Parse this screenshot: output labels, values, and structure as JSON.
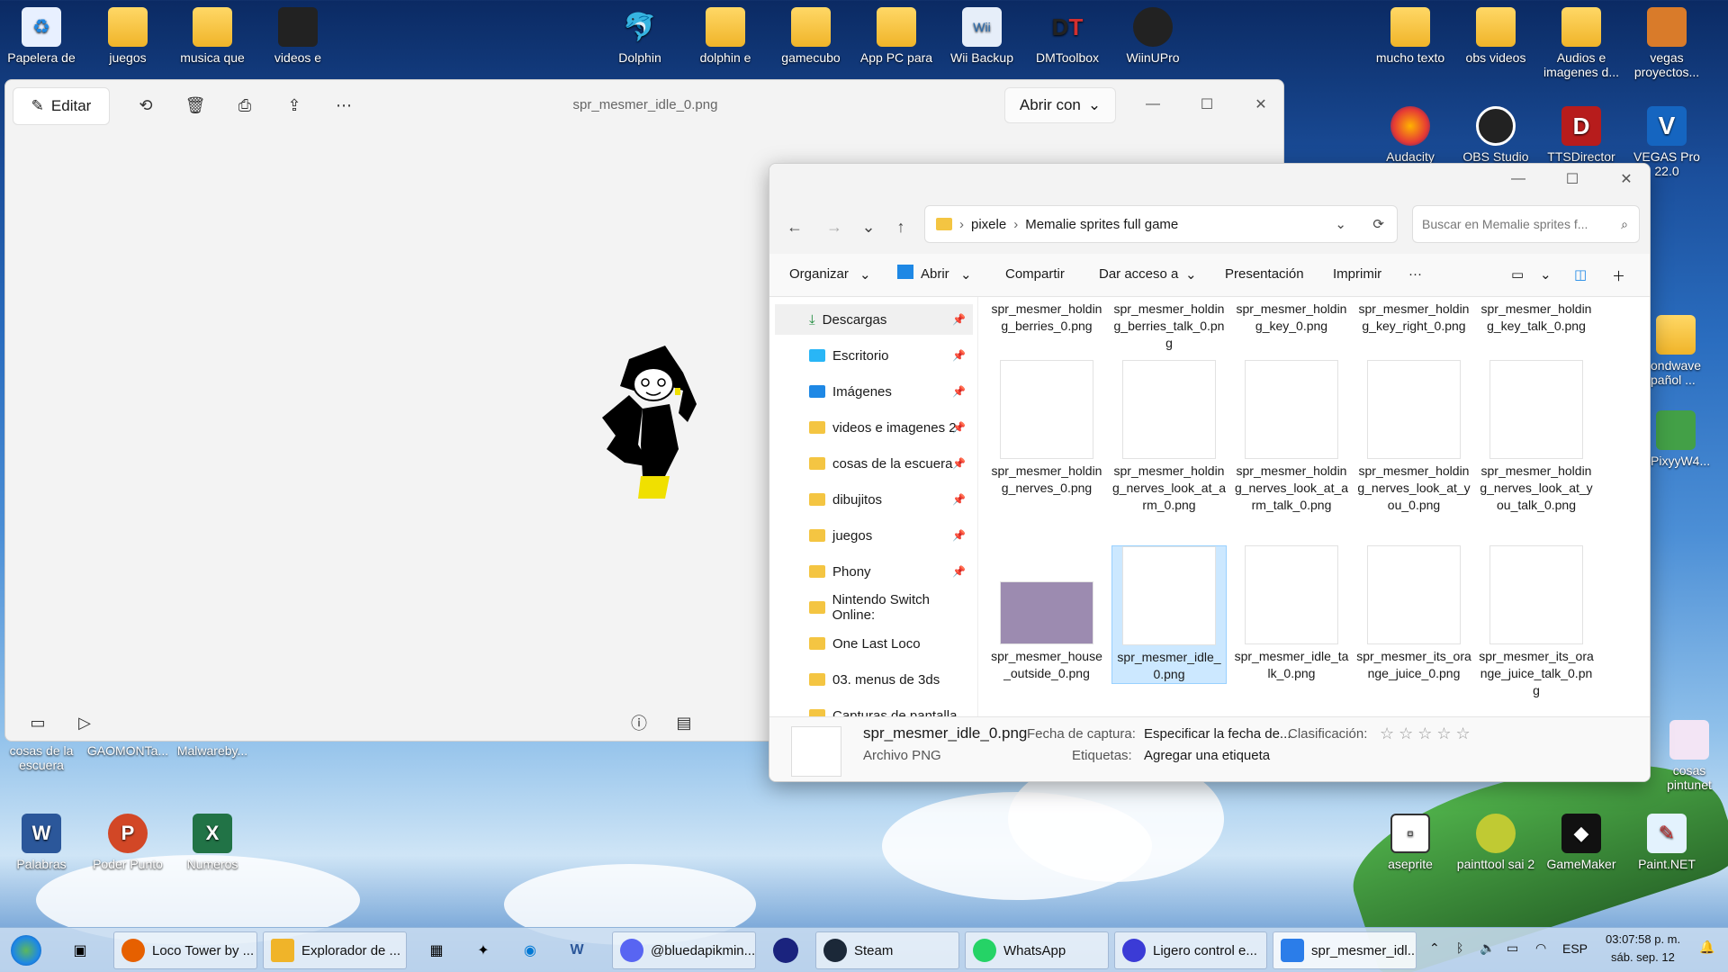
{
  "desktop_icons": [
    {
      "label": "Papelera de",
      "icon": "recycle-bin-icon"
    },
    {
      "label": "juegos",
      "icon": "folder-icon"
    },
    {
      "label": "musica que",
      "icon": "folder-icon"
    },
    {
      "label": "videos e",
      "icon": "folder-icon"
    },
    {
      "label": "Dolphin",
      "icon": "dolphin-icon"
    },
    {
      "label": "dolphin e",
      "icon": "folder-icon"
    },
    {
      "label": "gamecubo",
      "icon": "folder-icon"
    },
    {
      "label": "App PC para",
      "icon": "folder-icon"
    },
    {
      "label": "Wii Backup",
      "icon": "wii-backup-icon"
    },
    {
      "label": "DMToolbox",
      "icon": "dmtoolbox-icon"
    },
    {
      "label": "WiinUPro",
      "icon": "wiinupro-icon"
    },
    {
      "label": "mucho texto",
      "icon": "folder-icon"
    },
    {
      "label": "obs videos",
      "icon": "folder-icon"
    },
    {
      "label": "Audios e imagenes d...",
      "icon": "folder-icon"
    },
    {
      "label": "vegas proyectos...",
      "icon": "vegas-projects-icon"
    },
    {
      "label": "Audacity",
      "icon": "audacity-icon"
    },
    {
      "label": "OBS Studio",
      "icon": "obs-icon"
    },
    {
      "label": "TTSDirector",
      "icon": "tts-icon"
    },
    {
      "label": "VEGAS Pro 22.0",
      "icon": "vegas-icon"
    },
    {
      "label": "ondwave pañol ...",
      "icon": "folder-icon"
    },
    {
      "label": "PixyyW4...",
      "icon": "app-icon"
    },
    {
      "label": "cosas de la escuera",
      "icon": "folder-icon"
    },
    {
      "label": "GAOMONTa...",
      "icon": "app-icon"
    },
    {
      "label": "Malwareby...",
      "icon": "app-icon"
    },
    {
      "label": "Palabras",
      "icon": "word-icon"
    },
    {
      "label": "Poder Punto",
      "icon": "powerpoint-icon"
    },
    {
      "label": "Numeros",
      "icon": "excel-icon"
    },
    {
      "label": "cosas pintunet",
      "icon": "folder-icon"
    },
    {
      "label": "aseprite",
      "icon": "aseprite-icon"
    },
    {
      "label": "painttool sai 2",
      "icon": "painttool-icon"
    },
    {
      "label": "GameMaker",
      "icon": "gamemaker-icon"
    },
    {
      "label": "Paint.NET",
      "icon": "paintnet-icon"
    }
  ],
  "viewer": {
    "title": "spr_mesmer_idle_0.png",
    "edit_label": "Editar",
    "open_with_label": "Abrir con"
  },
  "explorer": {
    "breadcrumb": [
      "pixele",
      "Memalie sprites full game"
    ],
    "search_placeholder": "Buscar en Memalie sprites f...",
    "commands": {
      "organize": "Organizar",
      "open": "Abrir",
      "share": "Compartir",
      "access": "Dar acceso a",
      "slideshow": "Presentación",
      "print": "Imprimir",
      "more": "···"
    },
    "sidebar": [
      {
        "label": "Descargas",
        "icon": "download-icon",
        "pinned": true
      },
      {
        "label": "Escritorio",
        "icon": "desktop-icon",
        "pinned": true
      },
      {
        "label": "Imágenes",
        "icon": "pictures-icon",
        "pinned": true
      },
      {
        "label": "videos e imagenes 2",
        "icon": "folder-icon",
        "pinned": true
      },
      {
        "label": "cosas de la escuera",
        "icon": "folder-icon",
        "pinned": true
      },
      {
        "label": "dibujitos",
        "icon": "folder-icon",
        "pinned": true
      },
      {
        "label": "juegos",
        "icon": "folder-icon",
        "pinned": true
      },
      {
        "label": "Phony",
        "icon": "folder-icon",
        "pinned": true
      },
      {
        "label": "Nintendo Switch Online:",
        "icon": "folder-icon",
        "pinned": false
      },
      {
        "label": "One Last Loco",
        "icon": "folder-icon",
        "pinned": false
      },
      {
        "label": "03. menus de 3ds",
        "icon": "folder-icon",
        "pinned": false
      },
      {
        "label": "Capturas de pantalla",
        "icon": "folder-icon",
        "pinned": false
      }
    ],
    "files_row1": [
      "spr_mesmer_holding_berries_0.png",
      "spr_mesmer_holding_berries_talk_0.png",
      "spr_mesmer_holding_key_0.png",
      "spr_mesmer_holding_key_right_0.png",
      "spr_mesmer_holding_key_talk_0.png"
    ],
    "files_row2": [
      "spr_mesmer_holding_nerves_0.png",
      "spr_mesmer_holding_nerves_look_at_arm_0.png",
      "spr_mesmer_holding_nerves_look_at_arm_talk_0.png",
      "spr_mesmer_holding_nerves_look_at_you_0.png",
      "spr_mesmer_holding_nerves_look_at_you_talk_0.png"
    ],
    "files_row3": [
      "spr_mesmer_house_outside_0.png",
      "spr_mesmer_idle_0.png",
      "spr_mesmer_idle_talk_0.png",
      "spr_mesmer_its_orange_juice_0.png",
      "spr_mesmer_its_orange_juice_talk_0.png"
    ],
    "details": {
      "file_name": "spr_mesmer_idle_0.png",
      "file_type": "Archivo PNG",
      "capture_date_label": "Fecha de captura:",
      "capture_date_value": "Especificar la fecha de...",
      "rating_label": "Clasificación:",
      "tags_label": "Etiquetas:",
      "tags_value": "Agregar una etiqueta",
      "rating_stars": "☆ ☆ ☆ ☆ ☆"
    }
  },
  "taskbar": {
    "items": [
      {
        "label": "Loco Tower by ...",
        "icon": "firefox-icon",
        "color": "#e66000"
      },
      {
        "label": "Explorador de ...",
        "icon": "explorer-icon",
        "color": "#f0b429"
      },
      {
        "label": "@bluedapikmin...",
        "icon": "discord-icon",
        "color": "#5865f2"
      },
      {
        "label": "Steam",
        "icon": "steam-icon",
        "color": "#1b2838"
      },
      {
        "label": "WhatsApp",
        "icon": "whatsapp-icon",
        "color": "#25d366"
      },
      {
        "label": "Ligero control e...",
        "icon": "audio-control-icon",
        "color": "#3b3bd6"
      },
      {
        "label": "spr_mesmer_idl...",
        "icon": "photos-icon",
        "color": "#2b7de9"
      }
    ],
    "lang": "ESP",
    "time": "03:07:58 p. m.",
    "date": "sáb. sep. 12"
  }
}
